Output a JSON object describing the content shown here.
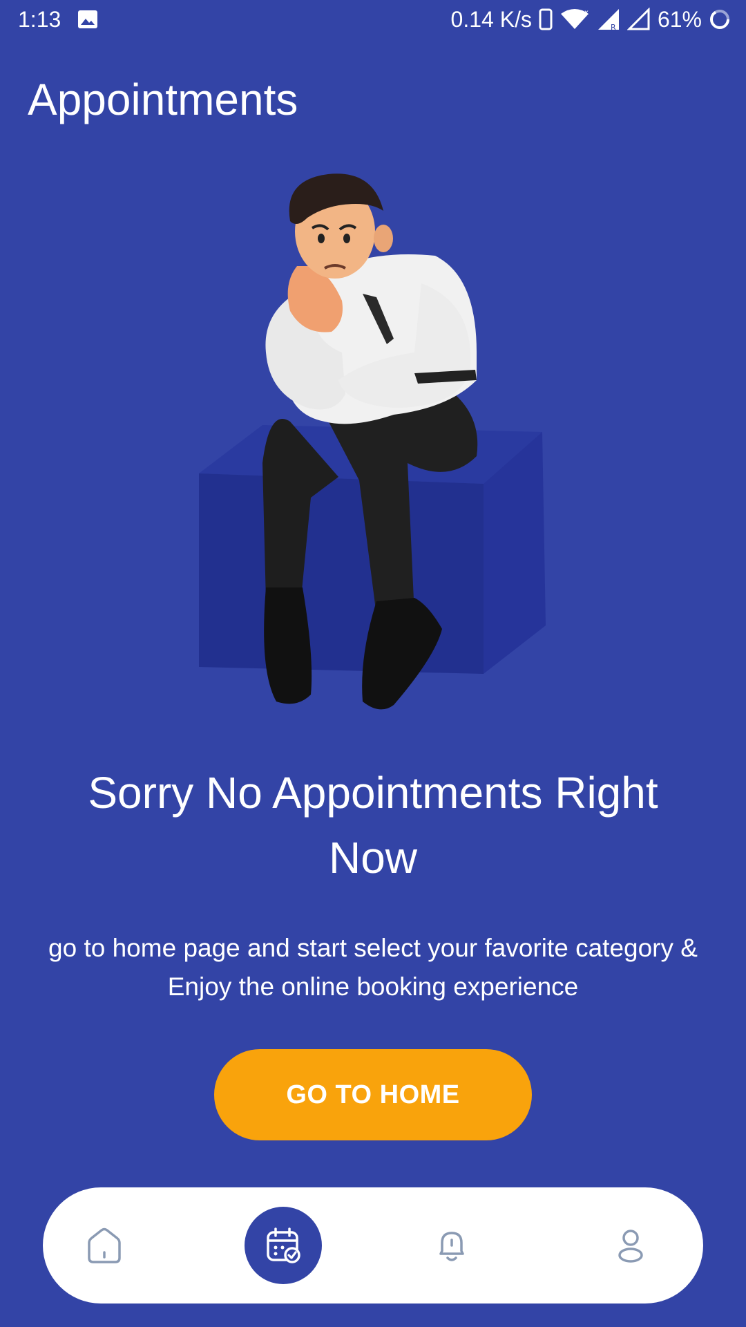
{
  "status_bar": {
    "time": "1:13",
    "network_speed": "0.14 K/s",
    "battery": "61%",
    "icons": [
      "gallery-icon",
      "phone-icon",
      "wifi-icon",
      "signal-icon",
      "signal-empty-icon",
      "battery-ring-icon"
    ]
  },
  "header": {
    "title": "Appointments"
  },
  "empty_state": {
    "title": "Sorry No Appointments Right Now",
    "description": "go to home page and start select your favorite category & Enjoy the online booking experience",
    "illustration": "sad-man-sitting-on-box"
  },
  "button": {
    "label": "GO TO HOME"
  },
  "bottom_nav": {
    "items": [
      {
        "icon": "home-icon",
        "active": false
      },
      {
        "icon": "calendar-check-icon",
        "active": true
      },
      {
        "icon": "bell-icon",
        "active": false
      },
      {
        "icon": "profile-icon",
        "active": false
      }
    ]
  },
  "colors": {
    "background": "#3344A6",
    "accent": "#F9A30C",
    "nav_background": "#FFFFFF",
    "nav_icon_inactive": "#8A9AB3"
  }
}
